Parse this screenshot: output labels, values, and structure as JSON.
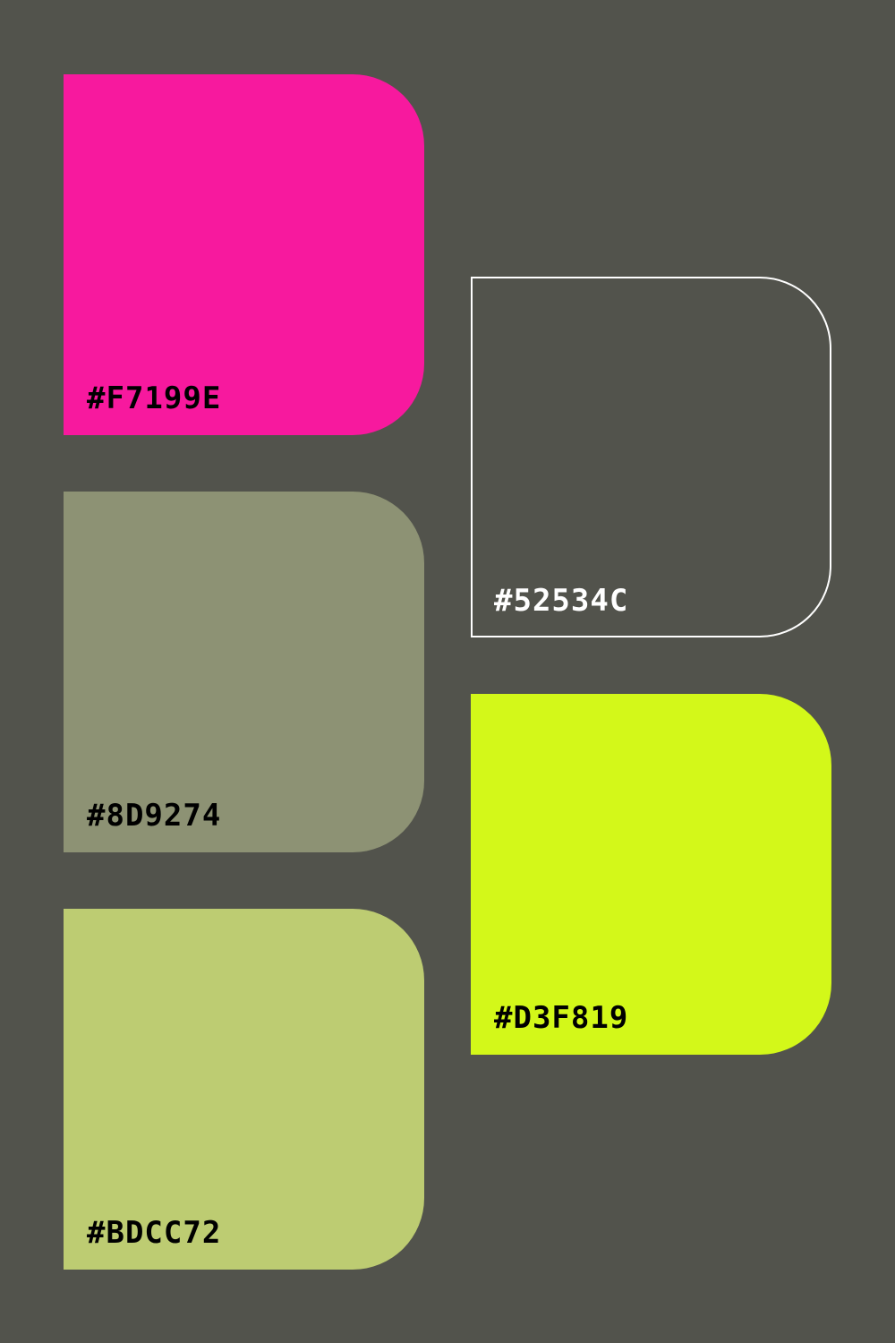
{
  "palette": {
    "background": "#52534C",
    "swatches": [
      {
        "label": "#F7199E",
        "color": "#F7199E",
        "text_color": "#000000"
      },
      {
        "label": "#8D9274",
        "color": "#8D9274",
        "text_color": "#000000"
      },
      {
        "label": "#BDCC72",
        "color": "#BDCC72",
        "text_color": "#000000"
      },
      {
        "label": "#52534C",
        "color": "#52534C",
        "text_color": "#FFFFFF",
        "outline": "#FFFFFF"
      },
      {
        "label": "#D3F819",
        "color": "#D3F819",
        "text_color": "#000000"
      }
    ]
  }
}
